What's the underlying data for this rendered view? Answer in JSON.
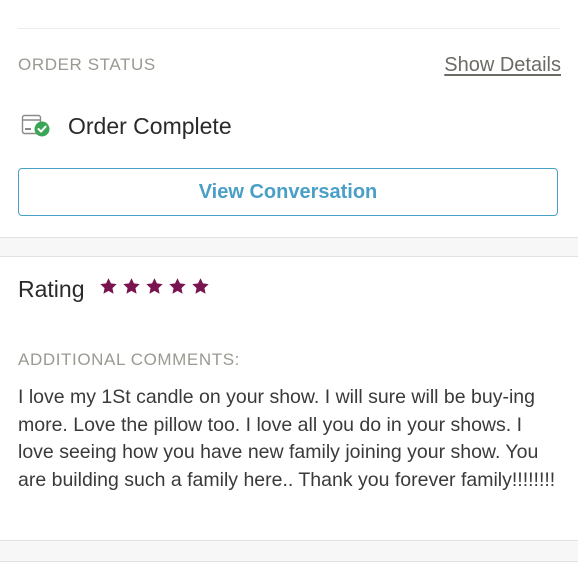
{
  "order": {
    "status_label": "ORDER STATUS",
    "show_details_label": "Show Details",
    "status_text": "Order Complete",
    "status_icon": "order-complete-icon",
    "status_color": "#3aa655",
    "view_conversation_label": "View Conversation"
  },
  "rating": {
    "label": "Rating",
    "stars": 5,
    "max_stars": 5,
    "star_color": "#7a1450"
  },
  "comments": {
    "label": "ADDITIONAL COMMENTS:",
    "text": "I love my 1St candle on your show. I will sure will be buy-ing more. Love the pillow too. I love all you do in your shows. I love seeing how you have new family joining your show. You are building such a family here.. Thank you forever family!!!!!!!!"
  },
  "colors": {
    "accent": "#4a9fc7",
    "muted_text": "#9a9a92"
  }
}
